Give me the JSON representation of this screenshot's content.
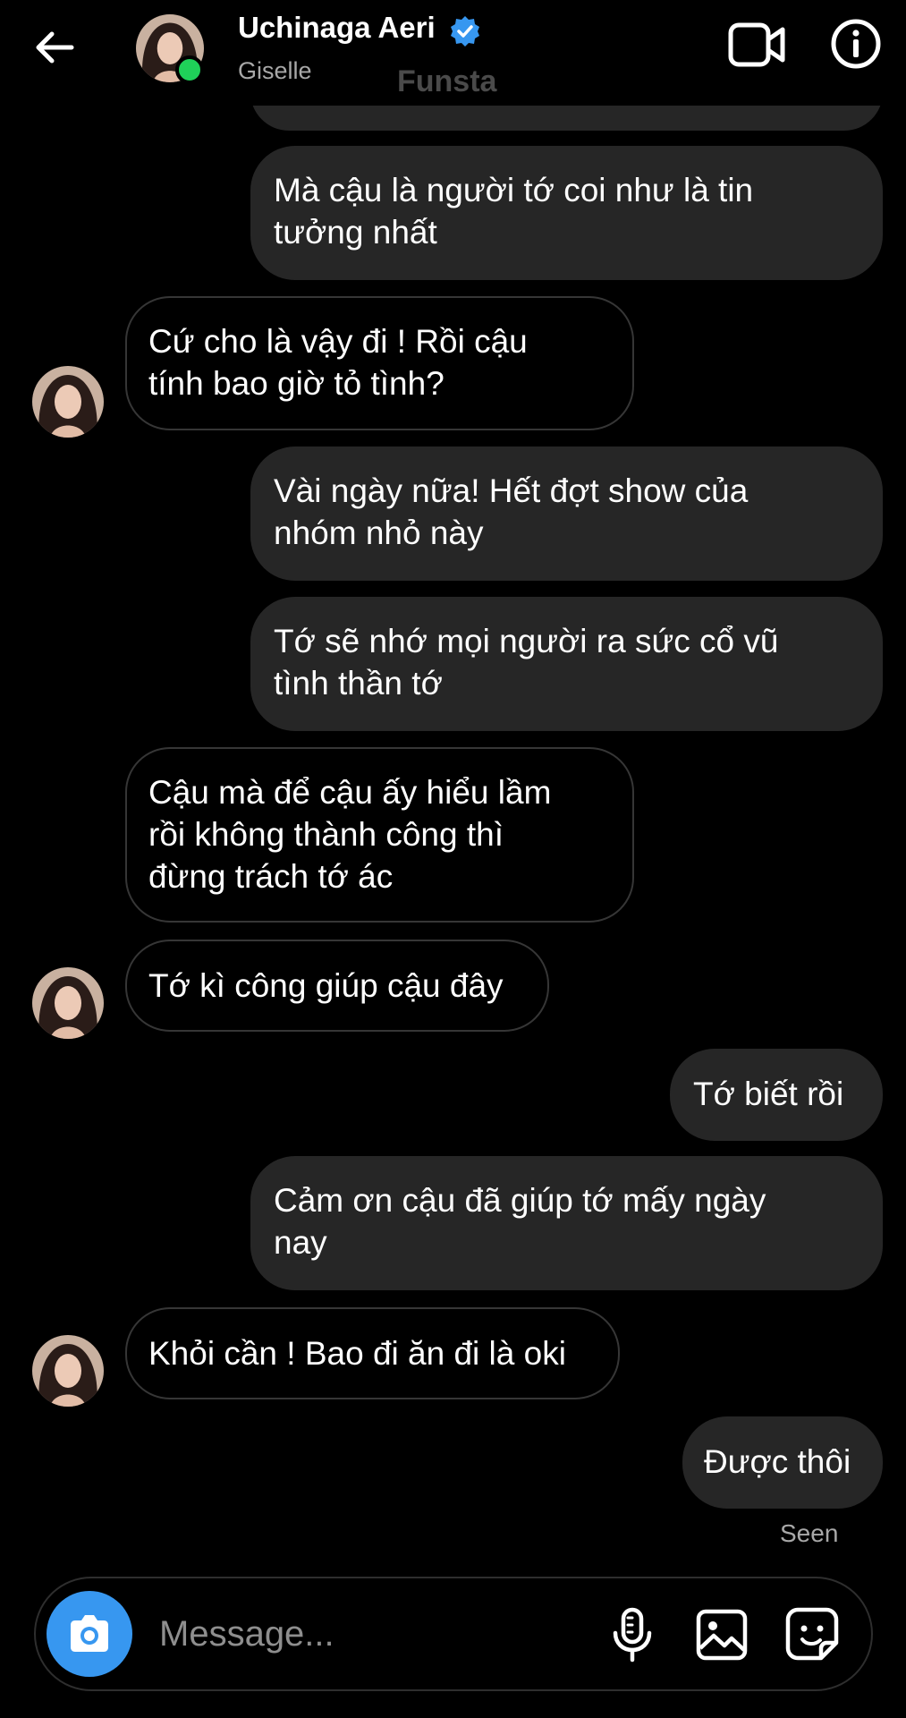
{
  "header": {
    "name": "Uchinaga Aeri",
    "subtitle": "Giselle",
    "overlay_text": "Funsta",
    "icons": {
      "back": "back-arrow-icon",
      "verified": "verified-badge-icon",
      "video": "video-call-icon",
      "info": "info-icon"
    }
  },
  "messages": [
    {
      "from": "me",
      "text": "Mà cậu là người tớ coi như là tin tưởng nhất",
      "lines": [
        "Mà cậu là người tớ coi như là tin",
        "tưởng nhất"
      ]
    },
    {
      "from": "them",
      "text": "Cứ cho là vậy đi ! Rồi cậu tính bao giờ tỏ tình?",
      "lines": [
        "Cứ cho là vậy đi ! Rồi cậu",
        "tính bao giờ tỏ tình?"
      ]
    },
    {
      "from": "me",
      "text": "Vài ngày nữa! Hết đợt show của nhóm nhỏ này",
      "lines": [
        "Vài ngày nữa! Hết đợt show của",
        "nhóm nhỏ này"
      ]
    },
    {
      "from": "me",
      "text": "Tớ sẽ nhớ mọi người ra sức cổ vũ tình thần tớ",
      "lines": [
        "Tớ sẽ nhớ mọi người ra sức cổ vũ",
        "tình thần tớ"
      ]
    },
    {
      "from": "them",
      "text": "Cậu mà để cậu ấy hiểu lầm rồi không thành công thì đừng trách tớ ác",
      "lines": [
        "Cậu mà để cậu ấy hiểu lầm",
        "rồi không thành công thì",
        "đừng trách tớ ác"
      ]
    },
    {
      "from": "them",
      "text": "Tớ kì công giúp cậu đây",
      "lines": [
        "Tớ kì công giúp cậu đây"
      ]
    },
    {
      "from": "me",
      "text": "Tớ biết rồi",
      "lines": [
        "Tớ biết rồi"
      ]
    },
    {
      "from": "me",
      "text": "Cảm ơn cậu đã giúp tớ mấy ngày nay",
      "lines": [
        "Cảm ơn cậu đã giúp tớ mấy ngày",
        "nay"
      ]
    },
    {
      "from": "them",
      "text": "Khỏi cần ! Bao đi ăn đi là oki",
      "lines": [
        "Khỏi cần ! Bao đi ăn đi là oki"
      ]
    },
    {
      "from": "me",
      "text": "Được thôi",
      "lines": [
        "Được thôi"
      ]
    }
  ],
  "status": {
    "seen": "Seen"
  },
  "composer": {
    "placeholder": "Message...",
    "icons": {
      "camera": "camera-icon",
      "mic": "microphone-icon",
      "gallery": "gallery-icon",
      "sticker": "sticker-icon"
    }
  },
  "colors": {
    "background": "#000000",
    "sent_bubble": "#262626",
    "received_border": "#363636",
    "accent": "#3797f0",
    "online": "#1fd159",
    "muted_text": "#a8a8a8"
  }
}
